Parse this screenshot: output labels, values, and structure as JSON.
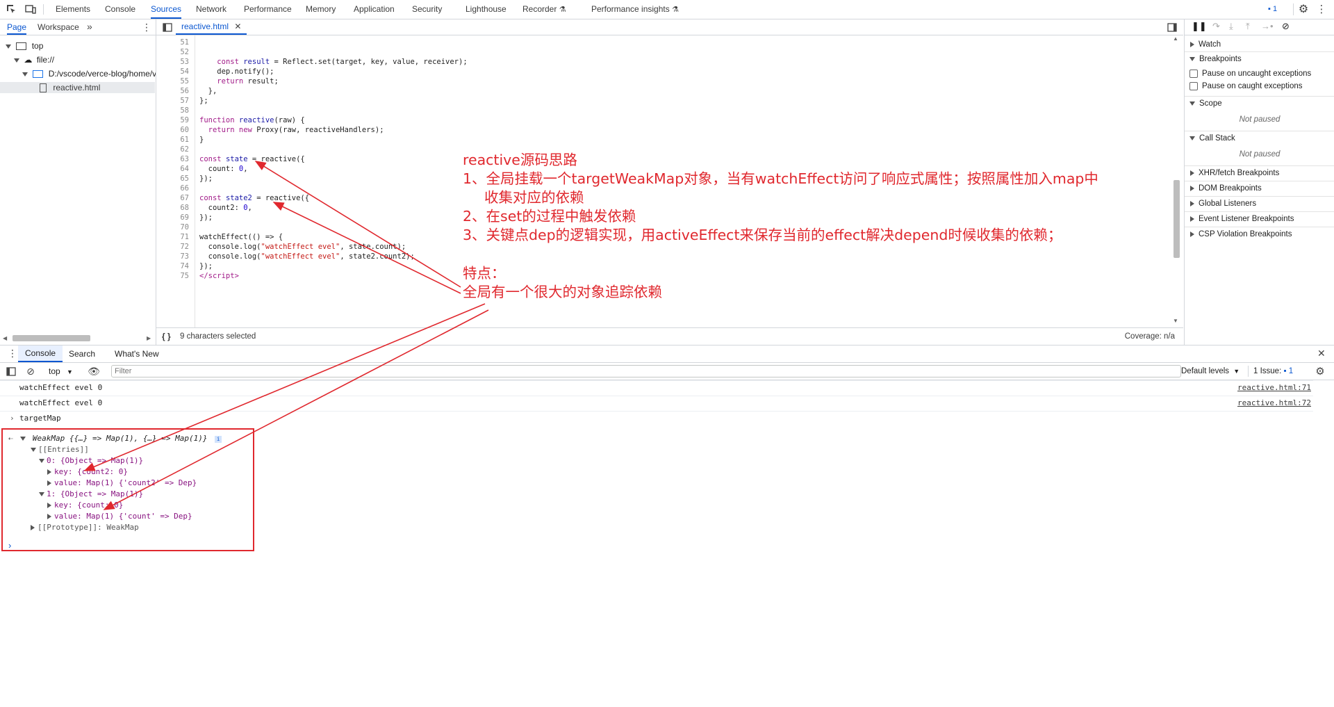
{
  "topbar": {
    "tabs": [
      "Elements",
      "Console",
      "Sources",
      "Network",
      "Performance",
      "Memory",
      "Application",
      "Security",
      "Lighthouse",
      "Recorder",
      "Performance insights"
    ],
    "active_tab": "Sources",
    "issues_count": "1"
  },
  "navigator": {
    "tabs": [
      "Page",
      "Workspace"
    ],
    "tree": [
      "top",
      "file://",
      "D:/vscode/verce-blog/home/v",
      "reactive.html"
    ]
  },
  "editor": {
    "file_tab": "reactive.html",
    "line_numbers": [
      "51",
      "52",
      "53",
      "54",
      "55",
      "56",
      "57",
      "58",
      "59",
      "60",
      "61",
      "62",
      "63",
      "64",
      "65",
      "66",
      "67",
      "68",
      "69",
      "70",
      "71",
      "72",
      "73",
      "74",
      "75"
    ],
    "status_selection": "9 characters selected",
    "status_coverage": "Coverage: n/a"
  },
  "debugger": {
    "watch": "Watch",
    "breakpoints": "Breakpoints",
    "pause_uncaught": "Pause on uncaught exceptions",
    "pause_caught": "Pause on caught exceptions",
    "scope": "Scope",
    "not_paused": "Not paused",
    "call_stack": "Call Stack",
    "xhr": "XHR/fetch Breakpoints",
    "dom": "DOM Breakpoints",
    "global": "Global Listeners",
    "event": "Event Listener Breakpoints",
    "csp": "CSP Violation Breakpoints"
  },
  "drawer": {
    "tabs": [
      "Console",
      "Search",
      "What's New"
    ],
    "context": "top",
    "filter_placeholder": "Filter",
    "levels": "Default levels",
    "issues_label": "1 Issue:",
    "issues_count": "1",
    "messages": [
      {
        "text": "watchEffect evel 0",
        "source": "reactive.html:71"
      },
      {
        "text": "watchEffect evel 0",
        "source": "reactive.html:72"
      }
    ],
    "input_echo": "targetMap",
    "result": {
      "summary": "WeakMap {{…} => Map(1), {…} => Map(1)}",
      "entries": "[[Entries]]",
      "e0": "0: {Object => Map(1)}",
      "e0_key": "key: {count2: 0}",
      "e0_value": "value: Map(1) {'count2' => Dep}",
      "e1": "1: {Object => Map(1)}",
      "e1_key": "key: {count: 0}",
      "e1_value": "value: Map(1) {'count' => Dep}",
      "proto": "[[Prototype]]: WeakMap"
    }
  },
  "annotation": {
    "title": "reactive源码思路",
    "p1a": "1、全局挂载一个targetWeakMap对象，当有watchEffect访问了响应式属性；按照属性加入map中",
    "p1b": "收集对应的依赖",
    "p2": "2、在set的过程中触发依赖",
    "p3": "3、关键点dep的逻辑实现，用activeEffect来保存当前的effect解决depend时候收集的依赖；",
    "feature_title": "特点：",
    "feature": "全局有一个很大的对象追踪依赖"
  },
  "colors": {
    "accent": "#0b57d0",
    "annotation": "#e0282e"
  }
}
